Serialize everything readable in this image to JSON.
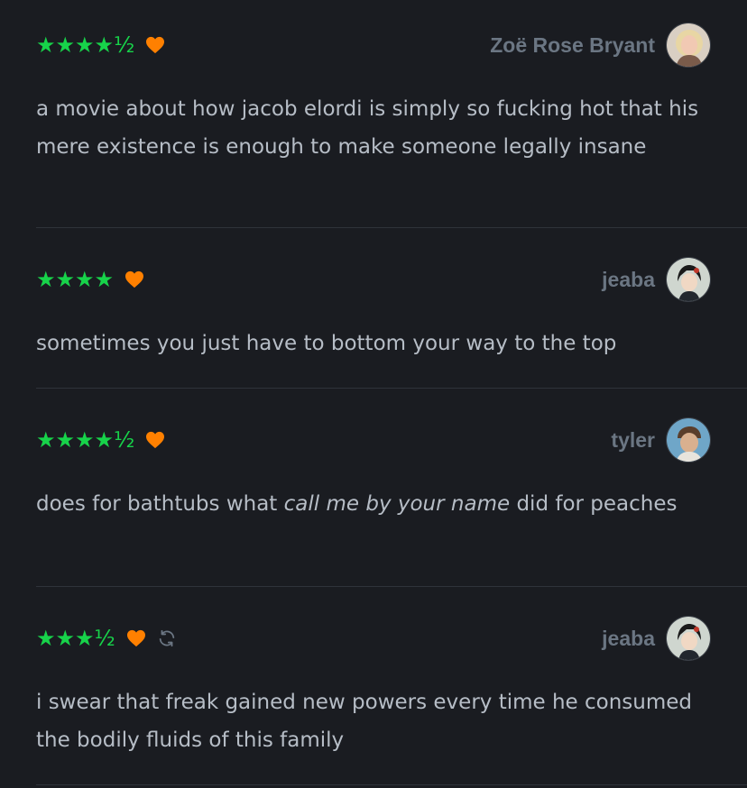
{
  "reviews": [
    {
      "rating_text": "★★★★½",
      "rating_value": 4.5,
      "liked": true,
      "rewatch": false,
      "author": "Zoë Rose Bryant",
      "avatar_icon": "user-avatar-blonde",
      "text_parts": [
        "a movie about how jacob elordi is simply so fucking hot that his mere existence is enough to make someone legally insane"
      ]
    },
    {
      "rating_text": "★★★★",
      "rating_value": 4,
      "liked": true,
      "rewatch": false,
      "author": "jeaba",
      "avatar_icon": "user-avatar-anime",
      "text_parts": [
        "sometimes you just have to bottom your way to the top"
      ]
    },
    {
      "rating_text": "★★★★½",
      "rating_value": 4.5,
      "liked": true,
      "rewatch": false,
      "author": "tyler",
      "avatar_icon": "user-avatar-photo",
      "text_parts": [
        "does for bathtubs what ",
        "call me by your name",
        " did for peaches"
      ]
    },
    {
      "rating_text": "★★★½",
      "rating_value": 3.5,
      "liked": true,
      "rewatch": true,
      "author": "jeaba",
      "avatar_icon": "user-avatar-anime",
      "text_parts": [
        "i swear that freak gained new powers every time he consumed the bodily fluids of this family"
      ]
    }
  ],
  "colors": {
    "background": "#1a1c21",
    "star": "#17d34a",
    "heart": "#ff8000",
    "author": "#6b7683",
    "body": "#b6bdc6",
    "divider": "#2f333a"
  }
}
